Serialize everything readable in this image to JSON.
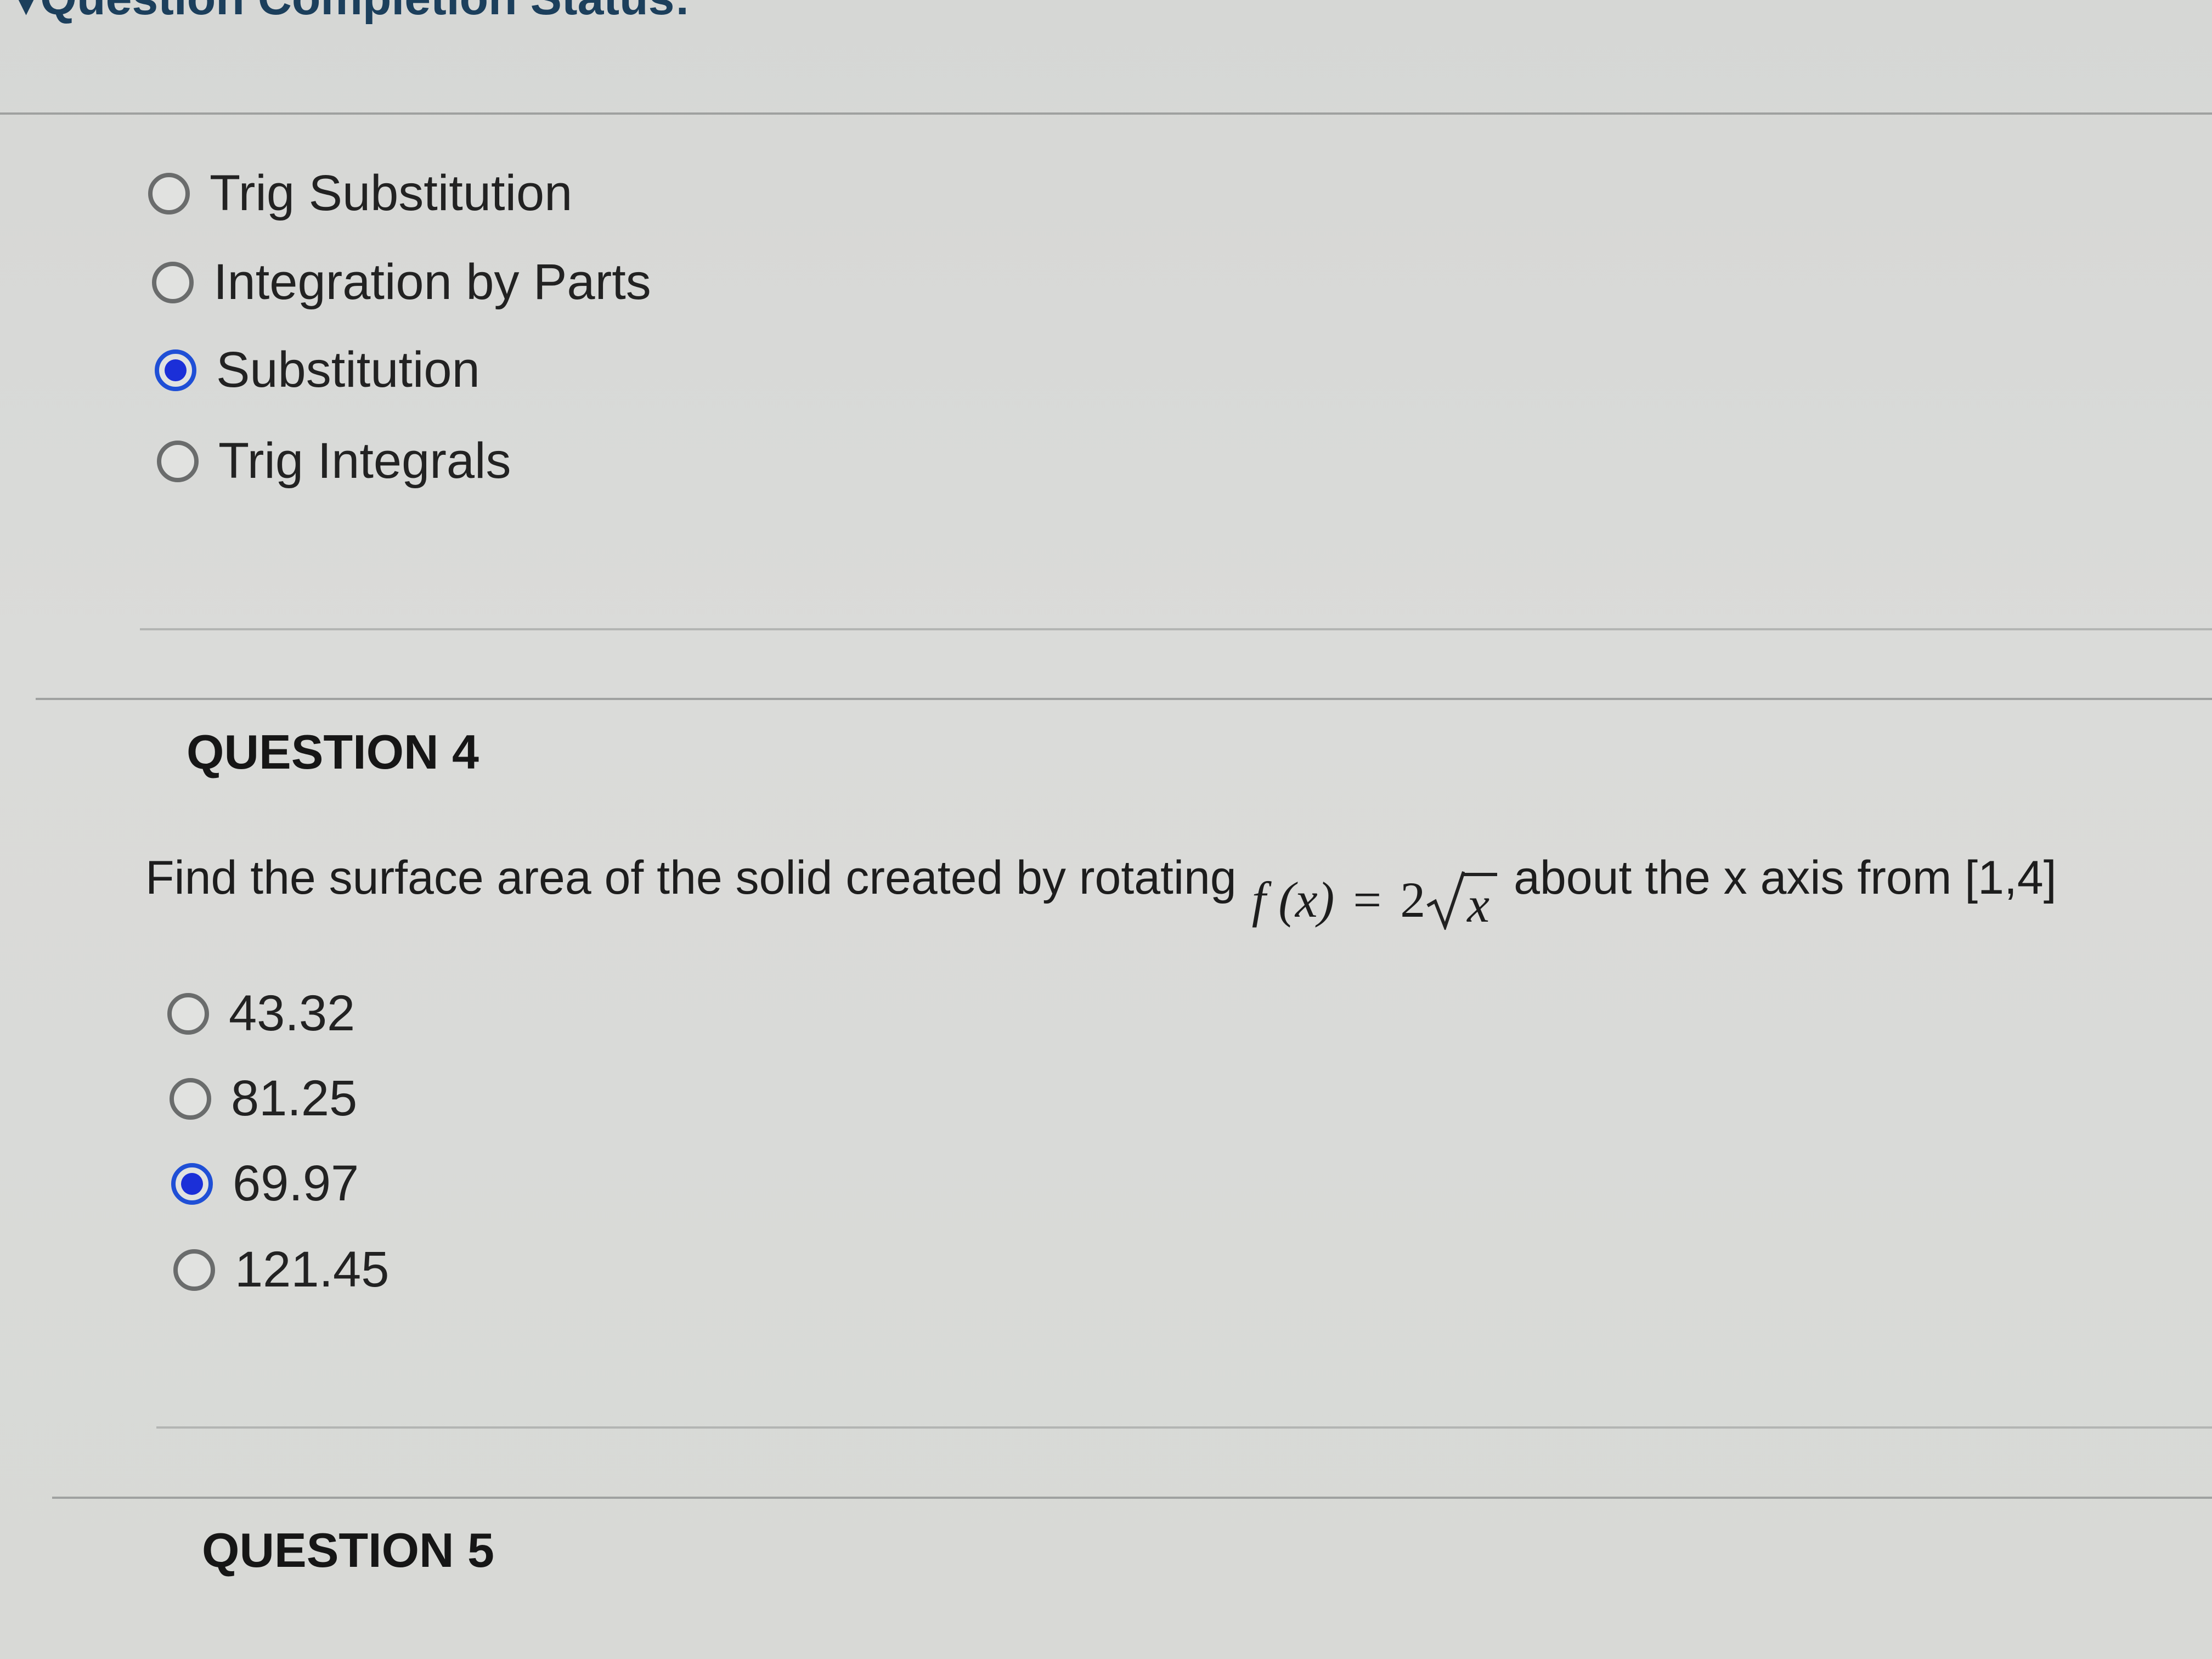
{
  "header": {
    "status_title": "Question Completion Status:"
  },
  "question3": {
    "options": [
      {
        "label": "Trig Substitution",
        "selected": false
      },
      {
        "label": "Integration by Parts",
        "selected": false
      },
      {
        "label": "Substitution",
        "selected": true
      },
      {
        "label": "Trig Integrals",
        "selected": false
      }
    ]
  },
  "question4": {
    "title": "QUESTION 4",
    "prompt_before": "Find the surface area of the solid created by rotating",
    "math": {
      "lhs": "f (x)",
      "equals": "=",
      "coefficient": "2",
      "radicand": "x"
    },
    "prompt_after": "about the x axis  from [1,4]",
    "options": [
      {
        "label": "43.32",
        "selected": false
      },
      {
        "label": "81.25",
        "selected": false
      },
      {
        "label": "69.97",
        "selected": true
      },
      {
        "label": "121.45",
        "selected": false
      }
    ]
  },
  "question5": {
    "title": "QUESTION 5"
  },
  "colors": {
    "selected_radio": "#1b2fd8",
    "header_text": "#1c3f5c"
  }
}
